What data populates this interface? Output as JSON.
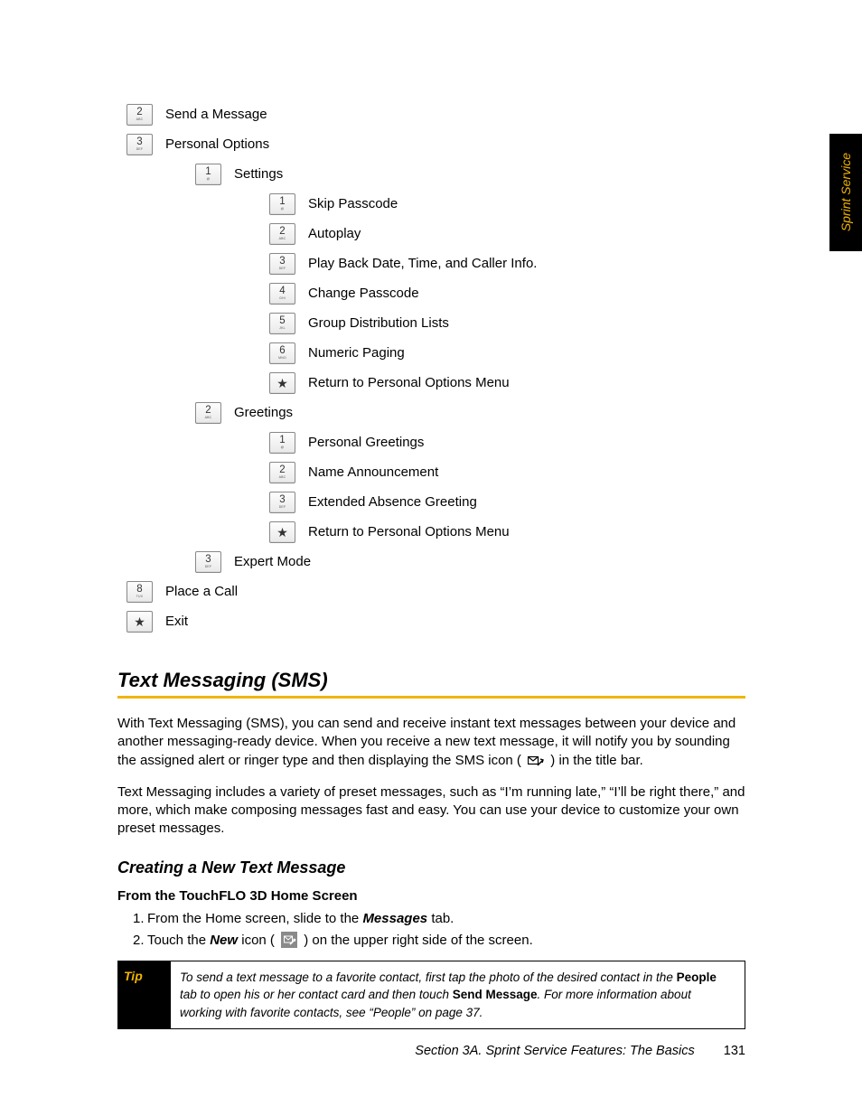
{
  "side_tab": "Sprint Service",
  "menu": [
    {
      "indent": 0,
      "key": "2",
      "sub": "ABC",
      "label": "Send a Message"
    },
    {
      "indent": 0,
      "key": "3",
      "sub": "DEF",
      "label": "Personal Options"
    },
    {
      "indent": 1,
      "key": "1",
      "sub": "@",
      "label": "Settings"
    },
    {
      "indent": 2,
      "key": "1",
      "sub": "@",
      "label": "Skip Passcode"
    },
    {
      "indent": 2,
      "key": "2",
      "sub": "ABC",
      "label": "Autoplay"
    },
    {
      "indent": 2,
      "key": "3",
      "sub": "DEF",
      "label": "Play Back Date, Time, and Caller Info."
    },
    {
      "indent": 2,
      "key": "4",
      "sub": "GHI",
      "label": "Change Passcode"
    },
    {
      "indent": 2,
      "key": "5",
      "sub": "JKL",
      "label": "Group Distribution Lists"
    },
    {
      "indent": 2,
      "key": "6",
      "sub": "MNO",
      "label": "Numeric Paging"
    },
    {
      "indent": 2,
      "key": "★",
      "sub": "",
      "label": "Return to Personal Options Menu"
    },
    {
      "indent": 1,
      "key": "2",
      "sub": "ABC",
      "label": "Greetings"
    },
    {
      "indent": 2,
      "key": "1",
      "sub": "@",
      "label": "Personal Greetings"
    },
    {
      "indent": 2,
      "key": "2",
      "sub": "ABC",
      "label": "Name Announcement"
    },
    {
      "indent": 2,
      "key": "3",
      "sub": "DEF",
      "label": "Extended Absence Greeting"
    },
    {
      "indent": 2,
      "key": "★",
      "sub": "",
      "label": "Return to Personal Options Menu"
    },
    {
      "indent": 1,
      "key": "3",
      "sub": "DEF",
      "label": "Expert Mode"
    },
    {
      "indent": 0,
      "key": "8",
      "sub": "TUV",
      "label": "Place a Call"
    },
    {
      "indent": 0,
      "key": "★",
      "sub": "",
      "label": "Exit"
    }
  ],
  "section_title": "Text Messaging (SMS)",
  "para1_a": "With Text Messaging (SMS), you can send and receive instant text messages between your device and another messaging-ready device. When you receive a new text message, it will notify you by sounding the assigned alert or ringer type and then displaying the SMS icon (",
  "para1_b": ") in the title bar.",
  "para2": "Text Messaging includes a variety of preset messages, such as “I’m running late,” “I’ll be right there,” and more, which make composing messages fast and easy. You can use your device to customize your own preset messages.",
  "subhead": "Creating a New Text Message",
  "sub_subhead": "From the TouchFLO 3D Home Screen",
  "step1_a": "From the Home screen, slide to the ",
  "step1_b": "Messages",
  "step1_c": " tab.",
  "step2_a": "Touch the ",
  "step2_b": "New",
  "step2_c": " icon (",
  "step2_d": ") on the upper right side of the screen.",
  "tip_label": "Tip",
  "tip_a": "To send a text message to a favorite contact, first tap the photo of the desired contact in the ",
  "tip_b": "People",
  "tip_c": " tab to open his or her contact card and then touch ",
  "tip_d": "Send Message",
  "tip_e": ". For more information about working with favorite contacts, see “People” on page 37.",
  "footer_text": "Section 3A. Sprint Service Features: The Basics",
  "footer_page": "131"
}
